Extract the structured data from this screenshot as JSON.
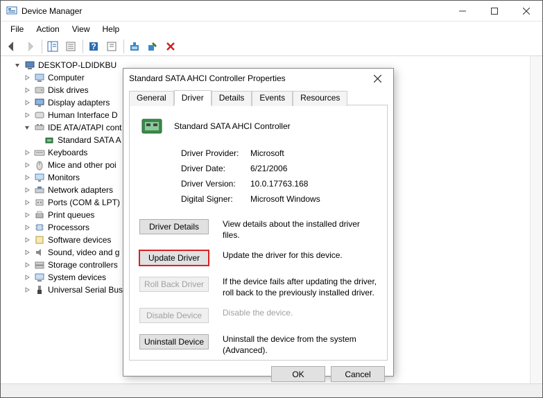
{
  "window": {
    "title": "Device Manager"
  },
  "menu": {
    "file": "File",
    "action": "Action",
    "view": "View",
    "help": "Help"
  },
  "tree": {
    "root": "DESKTOP-LDIDKBU",
    "nodes": [
      "Computer",
      "Disk drives",
      "Display adapters",
      "Human Interface Devices",
      "IDE ATA/ATAPI controllers",
      "Keyboards",
      "Mice and other pointing devices",
      "Monitors",
      "Network adapters",
      "Ports (COM & LPT)",
      "Print queues",
      "Processors",
      "Software devices",
      "Sound, video and game controllers",
      "Storage controllers",
      "System devices",
      "Universal Serial Bus controllers"
    ],
    "ide_child": "Standard SATA AHCI Controller"
  },
  "tree_display": {
    "computer": "Computer",
    "disk_drives": "Disk drives",
    "display_adapters": "Display adapters",
    "hid_trunc": "Human Interface D",
    "ide_trunc": "IDE ATA/ATAPI cont",
    "ide_child_trunc": "Standard SATA A",
    "keyboards": "Keyboards",
    "mice_trunc": "Mice and other poi",
    "monitors": "Monitors",
    "network": "Network adapters",
    "ports": "Ports (COM & LPT)",
    "print_queues": "Print queues",
    "processors": "Processors",
    "software": "Software devices",
    "sound_trunc": "Sound, video and g",
    "storage": "Storage controllers",
    "system": "System devices",
    "usb_trunc": "Universal Serial Bus"
  },
  "dialog": {
    "title": "Standard SATA AHCI Controller Properties",
    "tabs": {
      "general": "General",
      "driver": "Driver",
      "details": "Details",
      "events": "Events",
      "resources": "Resources"
    },
    "device_name": "Standard SATA AHCI Controller",
    "kv": {
      "provider_label": "Driver Provider:",
      "provider_value": "Microsoft",
      "date_label": "Driver Date:",
      "date_value": "6/21/2006",
      "version_label": "Driver Version:",
      "version_value": "10.0.17763.168",
      "signer_label": "Digital Signer:",
      "signer_value": "Microsoft Windows"
    },
    "actions": {
      "details_btn": "Driver Details",
      "details_desc": "View details about the installed driver files.",
      "update_btn": "Update Driver",
      "update_desc": "Update the driver for this device.",
      "rollback_btn": "Roll Back Driver",
      "rollback_desc": "If the device fails after updating the driver, roll back to the previously installed driver.",
      "disable_btn": "Disable Device",
      "disable_desc": "Disable the device.",
      "uninstall_btn": "Uninstall Device",
      "uninstall_desc": "Uninstall the device from the system (Advanced)."
    },
    "ok": "OK",
    "cancel": "Cancel"
  }
}
